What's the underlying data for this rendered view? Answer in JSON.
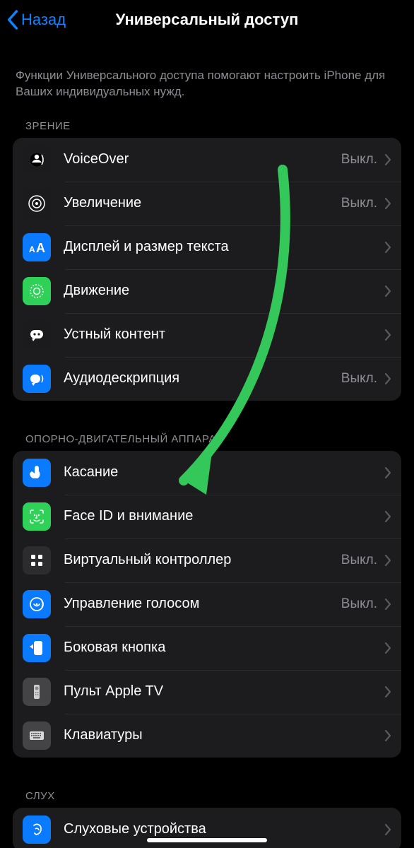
{
  "nav": {
    "back": "Назад",
    "title": "Универсальный доступ"
  },
  "intro": "Функции Универсального доступа помогают настроить iPhone для Ваших индивидуальных нужд.",
  "sections": {
    "vision": {
      "header": "ЗРЕНИЕ",
      "rows": {
        "voiceover": {
          "label": "VoiceOver",
          "value": "Выкл."
        },
        "zoom": {
          "label": "Увеличение",
          "value": "Выкл."
        },
        "display": {
          "label": "Дисплей и размер текста",
          "value": ""
        },
        "motion": {
          "label": "Движение",
          "value": ""
        },
        "spoken": {
          "label": "Устный контент",
          "value": ""
        },
        "audiodesc": {
          "label": "Аудиодескрипция",
          "value": "Выкл."
        }
      }
    },
    "motor": {
      "header": "ОПОРНО-ДВИГАТЕЛЬНЫЙ АППАРАТ",
      "rows": {
        "touch": {
          "label": "Касание",
          "value": ""
        },
        "faceid": {
          "label": "Face ID и внимание",
          "value": ""
        },
        "switchctrl": {
          "label": "Виртуальный контроллер",
          "value": "Выкл."
        },
        "voicectrl": {
          "label": "Управление голосом",
          "value": "Выкл."
        },
        "sidebutton": {
          "label": "Боковая кнопка",
          "value": ""
        },
        "appletv": {
          "label": "Пульт Apple TV",
          "value": ""
        },
        "keyboards": {
          "label": "Клавиатуры",
          "value": ""
        }
      }
    },
    "hearing": {
      "header": "СЛУХ",
      "rows": {
        "hearing": {
          "label": "Слуховые устройства",
          "value": ""
        }
      }
    }
  },
  "annotation": {
    "arrow_color": "#34c759"
  }
}
